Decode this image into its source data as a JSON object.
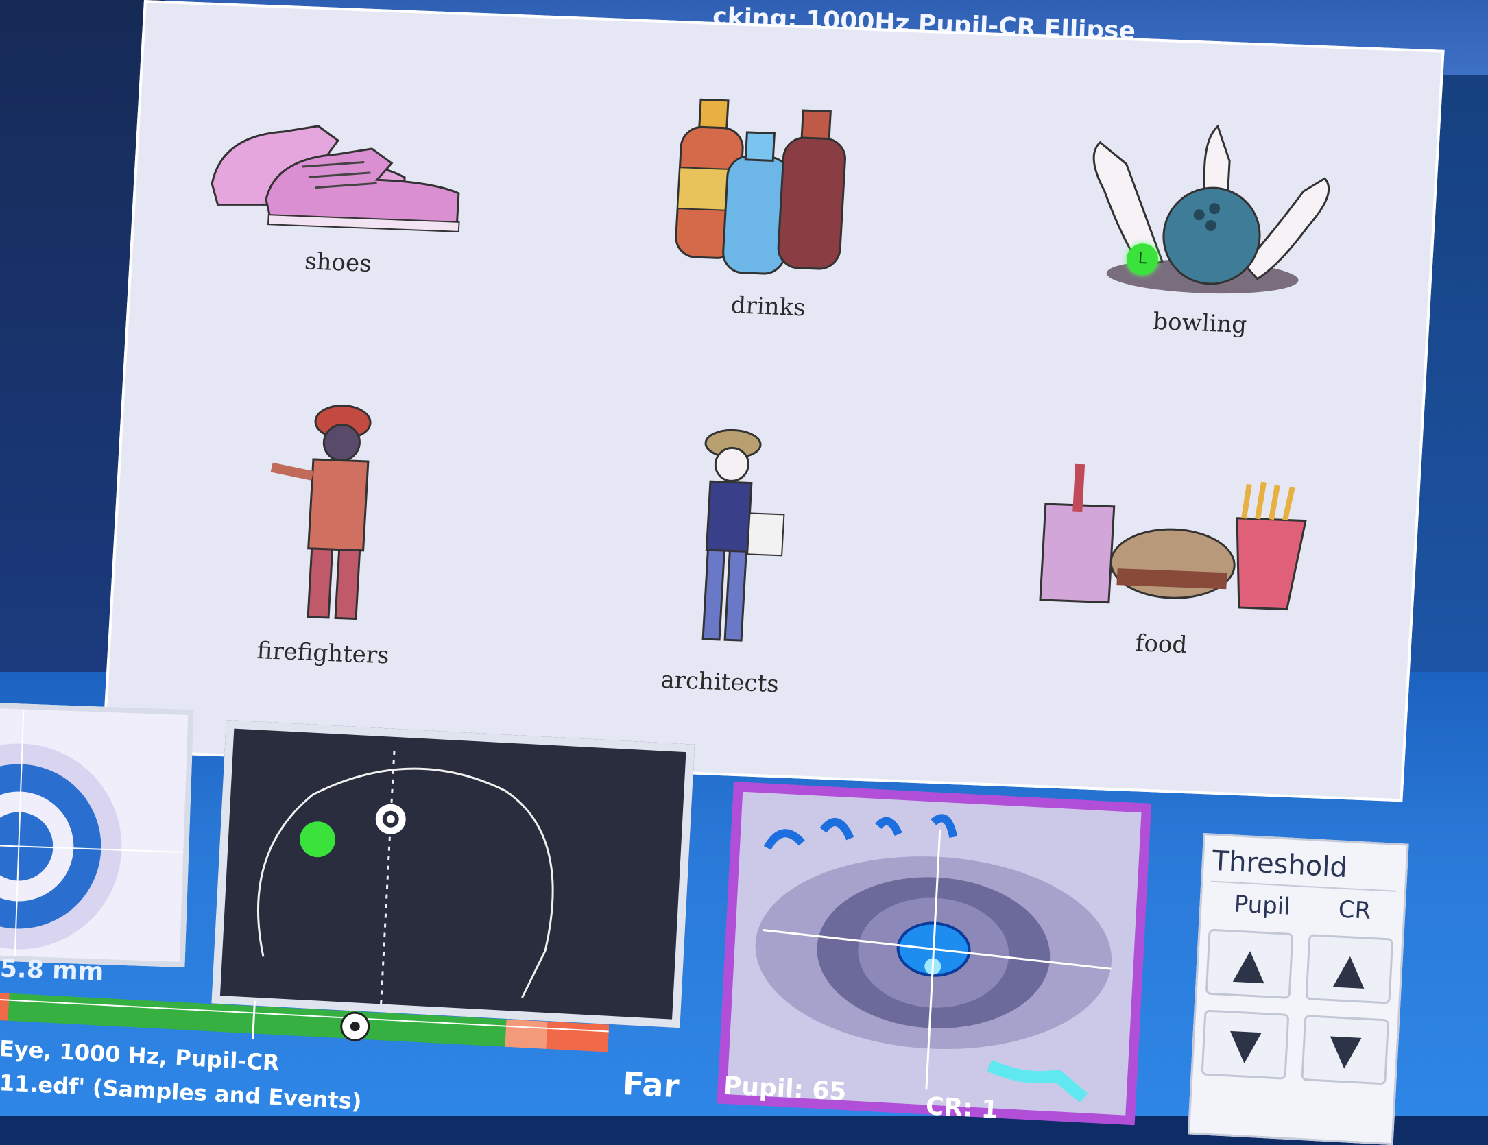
{
  "window": {
    "title": "cking: 1000Hz Pupil-CR Ellipse"
  },
  "stimulus": {
    "items": [
      {
        "label": "shoes",
        "icon": "shoes-icon"
      },
      {
        "label": "drinks",
        "icon": "drinks-icon"
      },
      {
        "label": "bowling",
        "icon": "bowling-icon"
      },
      {
        "label": "firefighters",
        "icon": "firefighter-icon"
      },
      {
        "label": "architects",
        "icon": "architect-icon"
      },
      {
        "label": "food",
        "icon": "food-icon"
      }
    ],
    "gaze_marker": "L"
  },
  "status": {
    "pupil_size": "5.8 mm",
    "distance_label": "Far",
    "tracking_info": "Eye, 1000 Hz, Pupil-CR",
    "file_info": "11.edf' (Samples and Events)",
    "pupil_value": "Pupil:  65",
    "cr_value": "CR: 1"
  },
  "threshold": {
    "title": "Threshold",
    "pupil_label": "Pupil",
    "cr_label": "CR",
    "up_symbol": "▲",
    "down_symbol": "▼"
  },
  "colors": {
    "accent": "#2e86e6",
    "gaze_green": "#3be23b",
    "camera_border": "#b24fd8"
  }
}
